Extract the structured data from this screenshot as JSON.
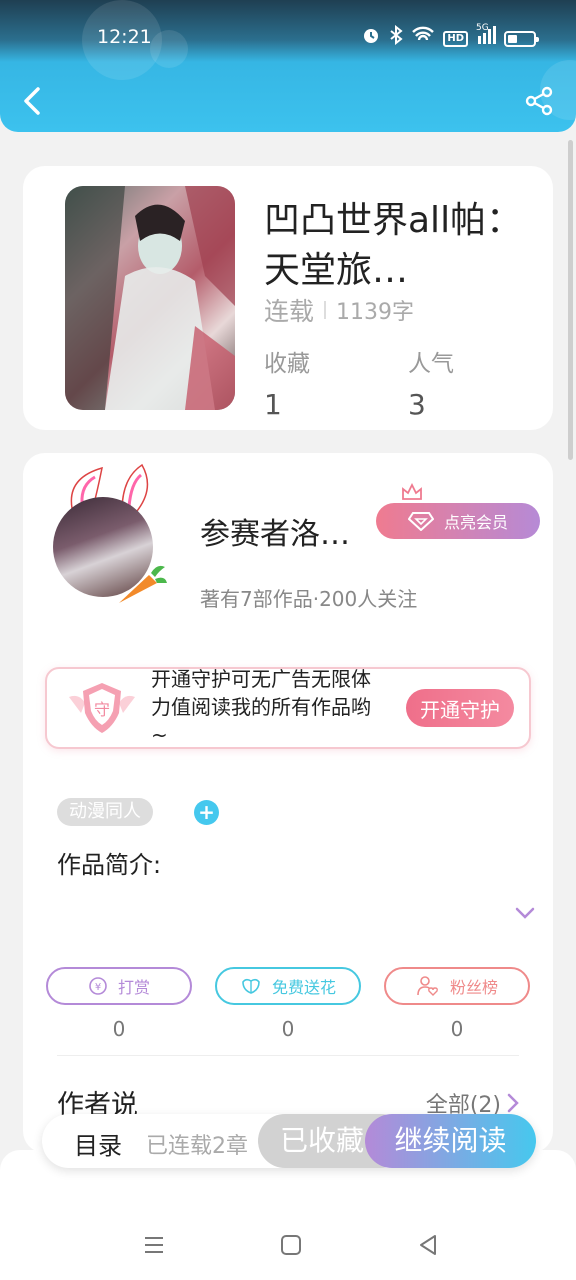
{
  "status_bar": {
    "time": "12:21",
    "signal_label": "5G",
    "hd_label": "HD"
  },
  "header": {
    "back_icon": "chevron-left-icon",
    "share_icon": "share-icon"
  },
  "book": {
    "title": "凹凸世界all帕：天堂旅…",
    "status": "连载",
    "word_count": "1139字",
    "favorites_label": "收藏",
    "favorites_value": "1",
    "popularity_label": "人气",
    "popularity_value": "3"
  },
  "author": {
    "name": "参赛者洛…",
    "stats": "著有7部作品·200人关注",
    "vip_button": "点亮会员"
  },
  "guard": {
    "badge_char": "守",
    "text": "开通守护可无广告无限体力值阅读我的所有作品哟~",
    "button": "开通守护"
  },
  "tags": {
    "tag1": "动漫同人",
    "add": "+"
  },
  "intro": {
    "label": "作品简介:"
  },
  "actions": [
    {
      "label": "打赏",
      "value": "0",
      "color": "#b48ad8"
    },
    {
      "label": "免费送花",
      "value": "0",
      "color": "#46c8e0"
    },
    {
      "label": "粉丝榜",
      "value": "0",
      "color": "#ef8a8a"
    }
  ],
  "author_says": {
    "label": "作者说",
    "see_all": "全部(2)"
  },
  "bottom_bar": {
    "toc": "目录",
    "chapters": "已连载2章",
    "favorited": "已收藏",
    "continue": "继续阅读"
  },
  "colors": {
    "accent": "#3cc2ee",
    "vip_pink": "#ef7b90",
    "purple": "#b48ad8"
  }
}
